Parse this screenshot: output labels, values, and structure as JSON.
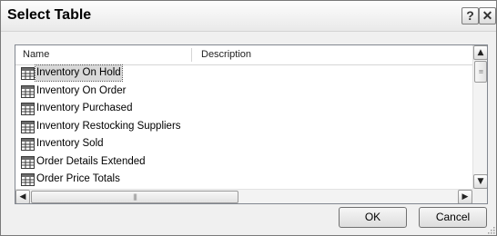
{
  "dialog": {
    "title": "Select Table",
    "help_label": "?",
    "close_label": "✕"
  },
  "list": {
    "columns": [
      "Name",
      "Description"
    ],
    "items": [
      {
        "label": "Inventory On Hold",
        "selected": true
      },
      {
        "label": "Inventory On Order"
      },
      {
        "label": "Inventory Purchased"
      },
      {
        "label": "Inventory Restocking Suppliers"
      },
      {
        "label": "Inventory Sold"
      },
      {
        "label": "Order Details Extended"
      },
      {
        "label": "Order Price Totals"
      }
    ],
    "icon": "table-icon"
  },
  "scrollbars": {
    "up_arrow": "▲",
    "down_arrow": "▼",
    "left_arrow": "◀",
    "right_arrow": "▶",
    "grip": "|||"
  },
  "buttons": {
    "ok_label": "OK",
    "cancel_label": "Cancel"
  }
}
